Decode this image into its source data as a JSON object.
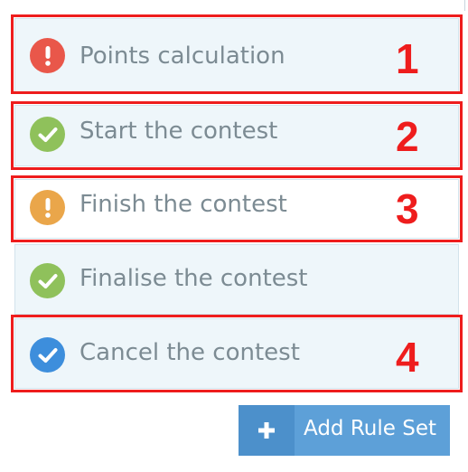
{
  "rules": [
    {
      "label": "Points calculation",
      "status": "error",
      "icon": "exclamation-icon",
      "color": "#e9574a",
      "annotation": "1"
    },
    {
      "label": "Start the contest",
      "status": "success",
      "icon": "check-icon",
      "color": "#8fc15b",
      "annotation": "2"
    },
    {
      "label": "Finish the contest",
      "status": "warning",
      "icon": "exclamation-icon",
      "color": "#eaa64a",
      "annotation": "3"
    },
    {
      "label": "Finalise the contest",
      "status": "success",
      "icon": "check-icon",
      "color": "#8fc15b",
      "annotation": ""
    },
    {
      "label": "Cancel the contest",
      "status": "info",
      "icon": "check-icon",
      "color": "#3d8edc",
      "annotation": "4"
    }
  ],
  "add_button": {
    "icon": "plus-icon",
    "label": "Add Rule Set"
  },
  "colors": {
    "annotation": "#ee1d1d",
    "button": "#5da0d8",
    "button_icon_segment": "#4c90cb"
  }
}
